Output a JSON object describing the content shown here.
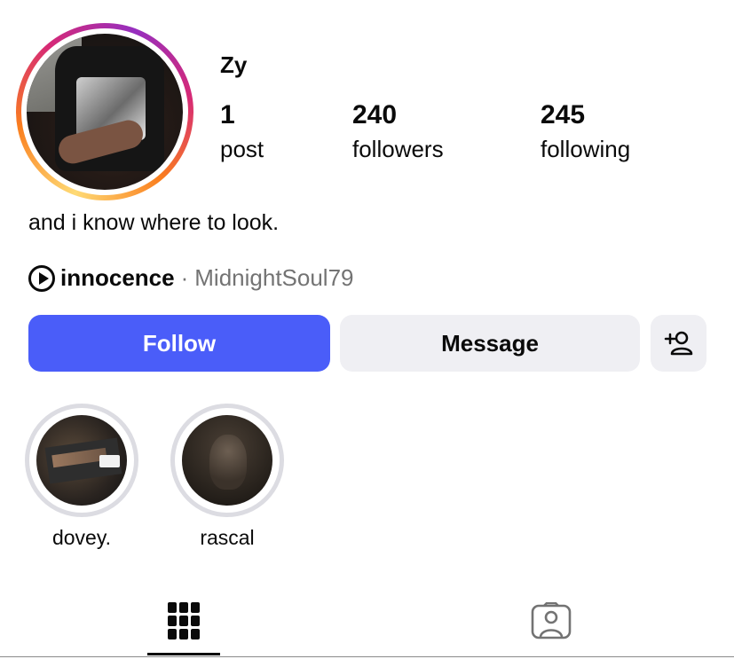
{
  "profile": {
    "username": "Zy",
    "avatar_icon": "profile-photo",
    "ring_colors": [
      "#feda75",
      "#fa7e1e",
      "#d62976",
      "#962fbf"
    ]
  },
  "stats": {
    "posts": {
      "count": "1",
      "label": "post"
    },
    "followers": {
      "count": "240",
      "label": "followers"
    },
    "following": {
      "count": "245",
      "label": "following"
    }
  },
  "bio": "and i know where to look.",
  "music": {
    "icon": "play-circle-icon",
    "song": "innocence",
    "separator": "·",
    "artist": "MidnightSoul79"
  },
  "actions": {
    "follow_label": "Follow",
    "message_label": "Message",
    "add_user_icon": "person-add-icon",
    "follow_color": "#4a5df9"
  },
  "highlights": [
    {
      "label": "dovey."
    },
    {
      "label": "rascal"
    }
  ],
  "tabs": [
    {
      "icon": "grid-icon",
      "active": true
    },
    {
      "icon": "tagged-person-icon",
      "active": false
    }
  ]
}
